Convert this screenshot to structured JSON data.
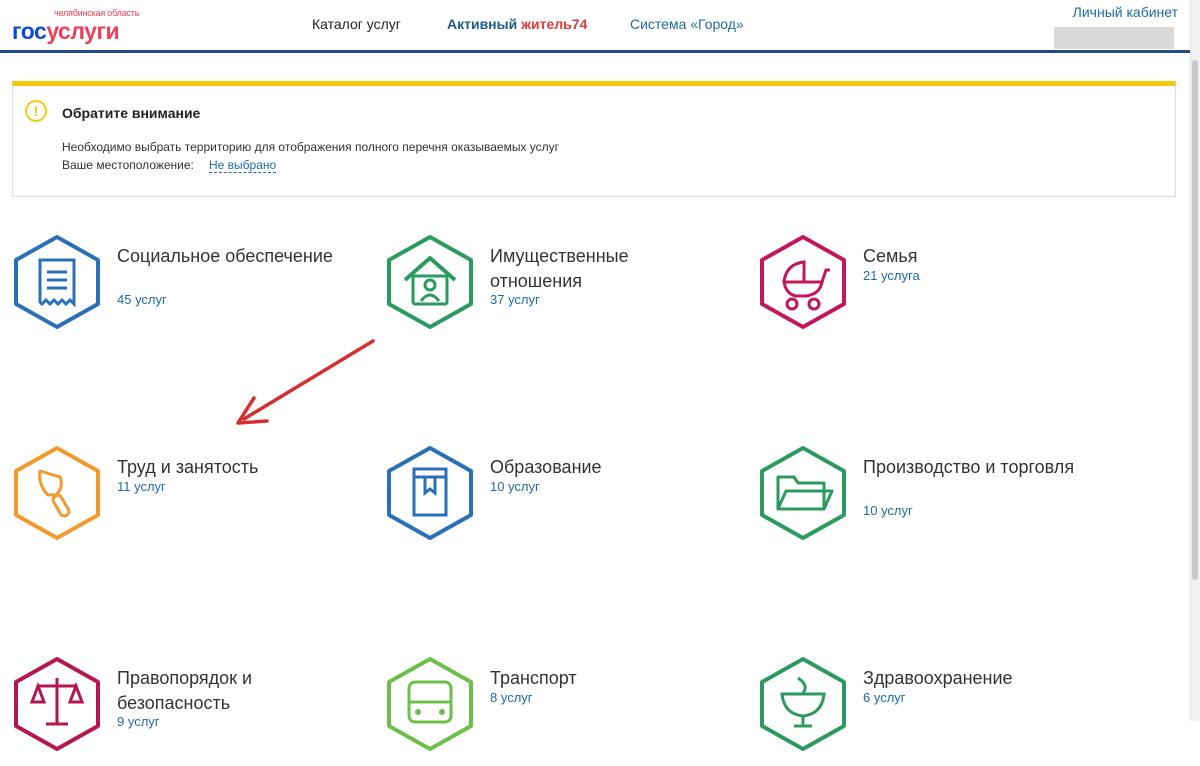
{
  "header": {
    "logo_region": "челябинская область",
    "logo_gos": "гос",
    "logo_uslugi": "услуги",
    "nav": {
      "catalog": "Каталог услуг",
      "active_part1": "Активный ",
      "active_part2": "житель74",
      "city": "Система «Город»"
    },
    "cabinet": "Личный кабинет"
  },
  "notice": {
    "title": "Обратите внимание",
    "text": "Необходимо выбрать территорию для отображения полного перечня оказываемых услуг",
    "location_label": "Ваше местоположение:",
    "location_value": "Не выбрано"
  },
  "categories": [
    {
      "title": "Социальное обеспечение",
      "count": "45 услуг",
      "icon": "receipt-icon",
      "color": "#2a70b8"
    },
    {
      "title": "Имущественные отношения",
      "count": "37 услуг",
      "icon": "house-person-icon",
      "color": "#2a9a5e"
    },
    {
      "title": "Семья",
      "count": "21 услуга",
      "icon": "baby-carriage-icon",
      "color": "#c2185b"
    },
    {
      "title": "Труд и занятость",
      "count": "11 услуг",
      "icon": "trowel-icon",
      "color": "#f29a2e"
    },
    {
      "title": "Образование",
      "count": "10 услуг",
      "icon": "book-icon",
      "color": "#2a70b8"
    },
    {
      "title": "Производство и торговля",
      "count": "10 услуг",
      "icon": "folder-icon",
      "color": "#2a9a5e"
    },
    {
      "title": "Правопорядок и безопасность",
      "count": "9 услуг",
      "icon": "scales-icon",
      "color": "#b5174a"
    },
    {
      "title": "Транспорт",
      "count": "8 услуг",
      "icon": "bus-icon",
      "color": "#6cc04a"
    },
    {
      "title": "Здравоохранение",
      "count": "6 услуг",
      "icon": "medicine-icon",
      "color": "#2a9a5e"
    }
  ],
  "colors": {
    "header_line": "#234a86",
    "notice_accent": "#f2c811",
    "link": "#1d6aa8",
    "annotation_arrow": "#d32f2f"
  }
}
